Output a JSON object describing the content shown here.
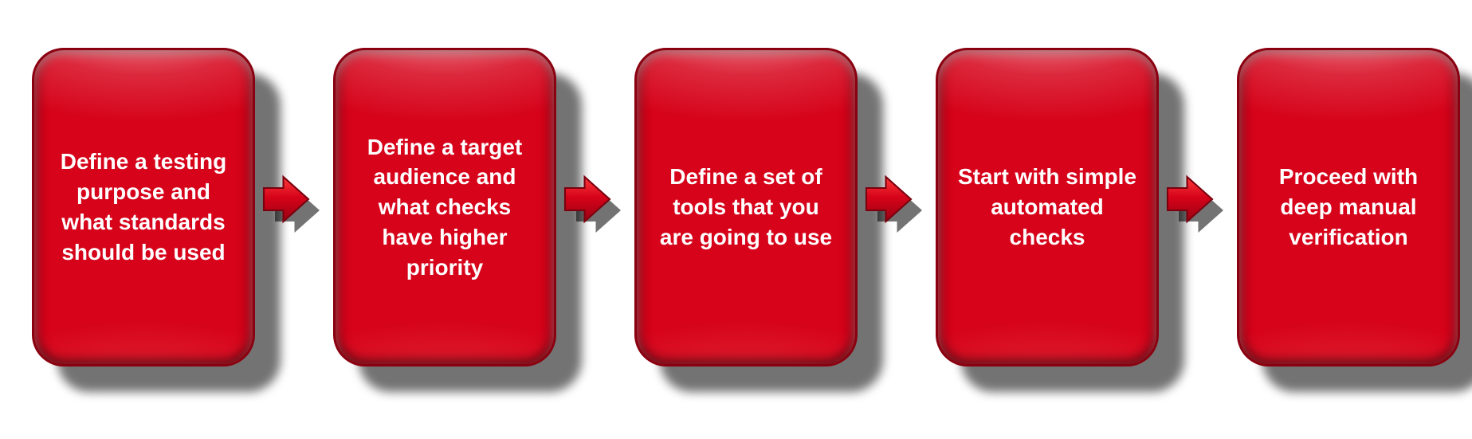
{
  "flow": {
    "steps": [
      {
        "label": "Define a testing purpose and what standards should be used"
      },
      {
        "label": "Define a target audience and what checks have higher priority"
      },
      {
        "label": "Define a set of tools that you are going to use"
      },
      {
        "label": "Start with simple automated checks"
      },
      {
        "label": "Proceed with deep manual verification"
      }
    ],
    "colors": {
      "box_fill": "#d6031a",
      "box_border": "#8a0010",
      "text": "#ffffff",
      "shadow": "rgba(0,0,0,0.55)"
    }
  }
}
